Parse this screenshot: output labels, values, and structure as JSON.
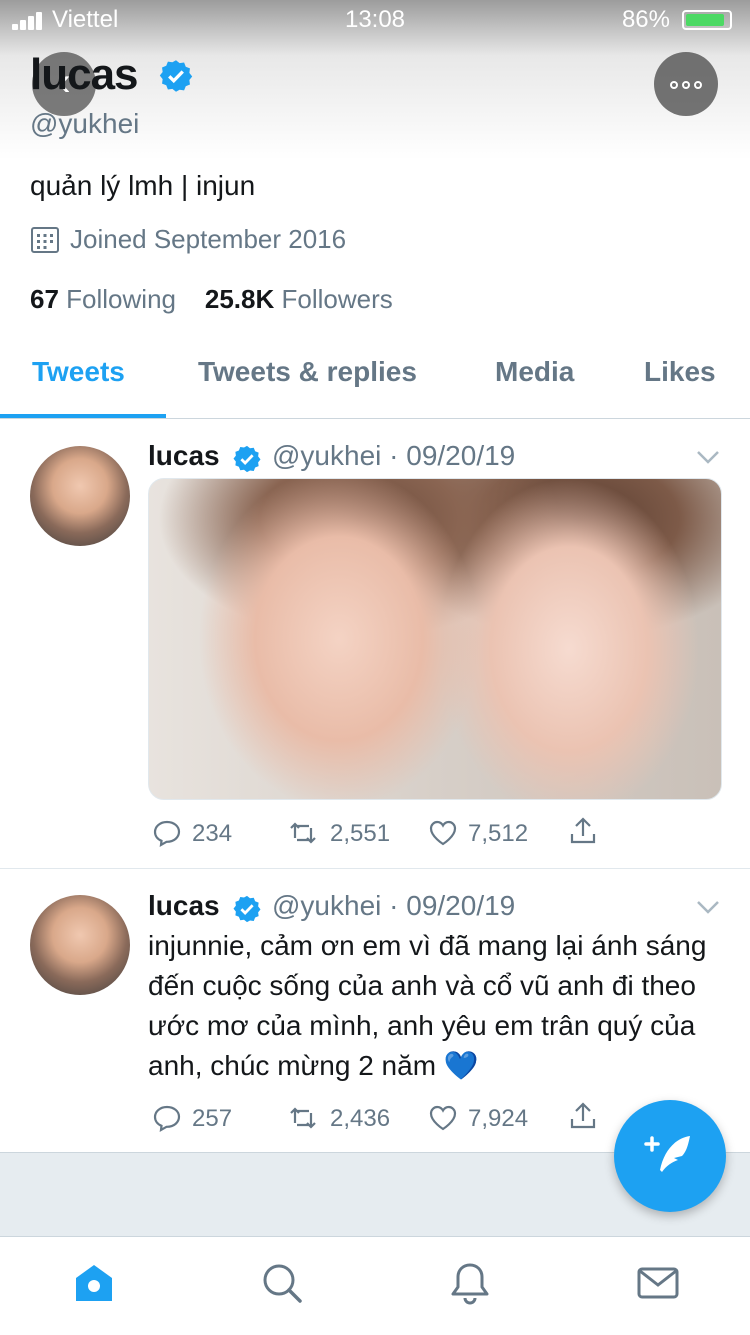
{
  "status_bar": {
    "carrier": "Viettel",
    "time": "13:08",
    "battery": "86%"
  },
  "profile": {
    "name": "lucas",
    "handle": "@yukhei",
    "bio": "quản lý lmh | injun",
    "joined": "Joined September 2016",
    "following_count": "67",
    "following_label": "Following",
    "followers_count": "25.8K",
    "followers_label": "Followers"
  },
  "tabs": [
    {
      "label": "Tweets",
      "active": true
    },
    {
      "label": "Tweets & replies",
      "active": false
    },
    {
      "label": "Media",
      "active": false
    },
    {
      "label": "Likes",
      "active": false
    }
  ],
  "tweets": [
    {
      "name": "lucas",
      "meta": "@yukhei · 09/20/19",
      "text": "",
      "has_media": true,
      "replies": "234",
      "retweets": "2,551",
      "likes": "7,512"
    },
    {
      "name": "lucas",
      "meta": "@yukhei · 09/20/19",
      "text": "injunnie, cảm ơn em vì đã mang lại ánh sáng đến cuộc sống của anh và cổ vũ anh đi theo ước mơ của mình, anh yêu em trân quý của anh, chúc mừng 2 năm 💙",
      "has_media": false,
      "replies": "257",
      "retweets": "2,436",
      "likes": "7,924"
    }
  ],
  "colors": {
    "accent": "#1da1f2",
    "secondary_text": "#657786",
    "divider": "#e1e8ed"
  },
  "icons": [
    "back-icon",
    "more-icon",
    "verified-icon",
    "calendar-icon",
    "reply-icon",
    "retweet-icon",
    "like-icon",
    "share-icon",
    "compose-icon",
    "home-icon",
    "search-icon",
    "notifications-icon",
    "messages-icon"
  ]
}
